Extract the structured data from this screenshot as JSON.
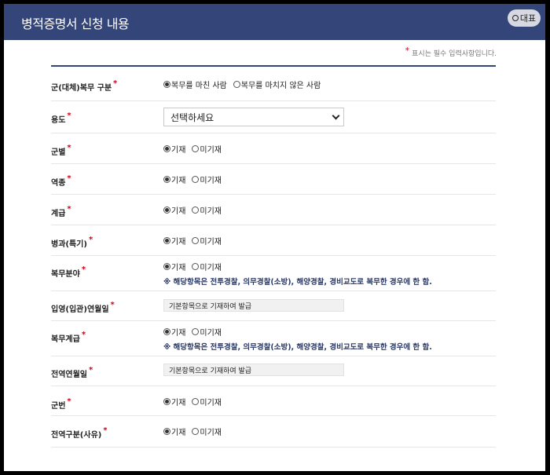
{
  "header": {
    "title": "병적증명서 신청 내용",
    "toggle_label": "대표"
  },
  "required_note": "표시는 필수 입력사항입니다.",
  "rows": [
    {
      "label": "군(대체)복무 구분",
      "options": [
        "복무를 마친 사람",
        "복무를 마치지 않은 사람"
      ],
      "selected": 0
    },
    {
      "label": "용도",
      "select_value": "선택하세요"
    },
    {
      "label": "군별",
      "options": [
        "기재",
        "미기재"
      ],
      "selected": 0
    },
    {
      "label": "역종",
      "options": [
        "기재",
        "미기재"
      ],
      "selected": 0
    },
    {
      "label": "계급",
      "options": [
        "기재",
        "미기재"
      ],
      "selected": 0
    },
    {
      "label": "병과(특기)",
      "options": [
        "기재",
        "미기재"
      ],
      "selected": 0
    },
    {
      "label": "복무분야",
      "options": [
        "기재",
        "미기재"
      ],
      "selected": 0,
      "note": "※ 해당항목은 전투경찰, 의무경찰(소방), 해양경찰, 경비교도로 복무한 경우에 한 함."
    },
    {
      "label": "입영(입관)연월일",
      "input_value": "기본항목으로 기재하여 발급"
    },
    {
      "label": "복무계급",
      "options": [
        "기재",
        "미기재"
      ],
      "selected": 0,
      "note": "※ 해당항목은 전투경찰, 의무경찰(소방), 해양경찰, 경비교도로 복무한 경우에 한 함."
    },
    {
      "label": "전역연월일",
      "input_value": "기본항목으로 기재하여 발급"
    },
    {
      "label": "군번",
      "options": [
        "기재",
        "미기재"
      ],
      "selected": 0
    },
    {
      "label": "전역구분(사유)",
      "options": [
        "기재",
        "미기재"
      ],
      "selected": 0
    }
  ]
}
